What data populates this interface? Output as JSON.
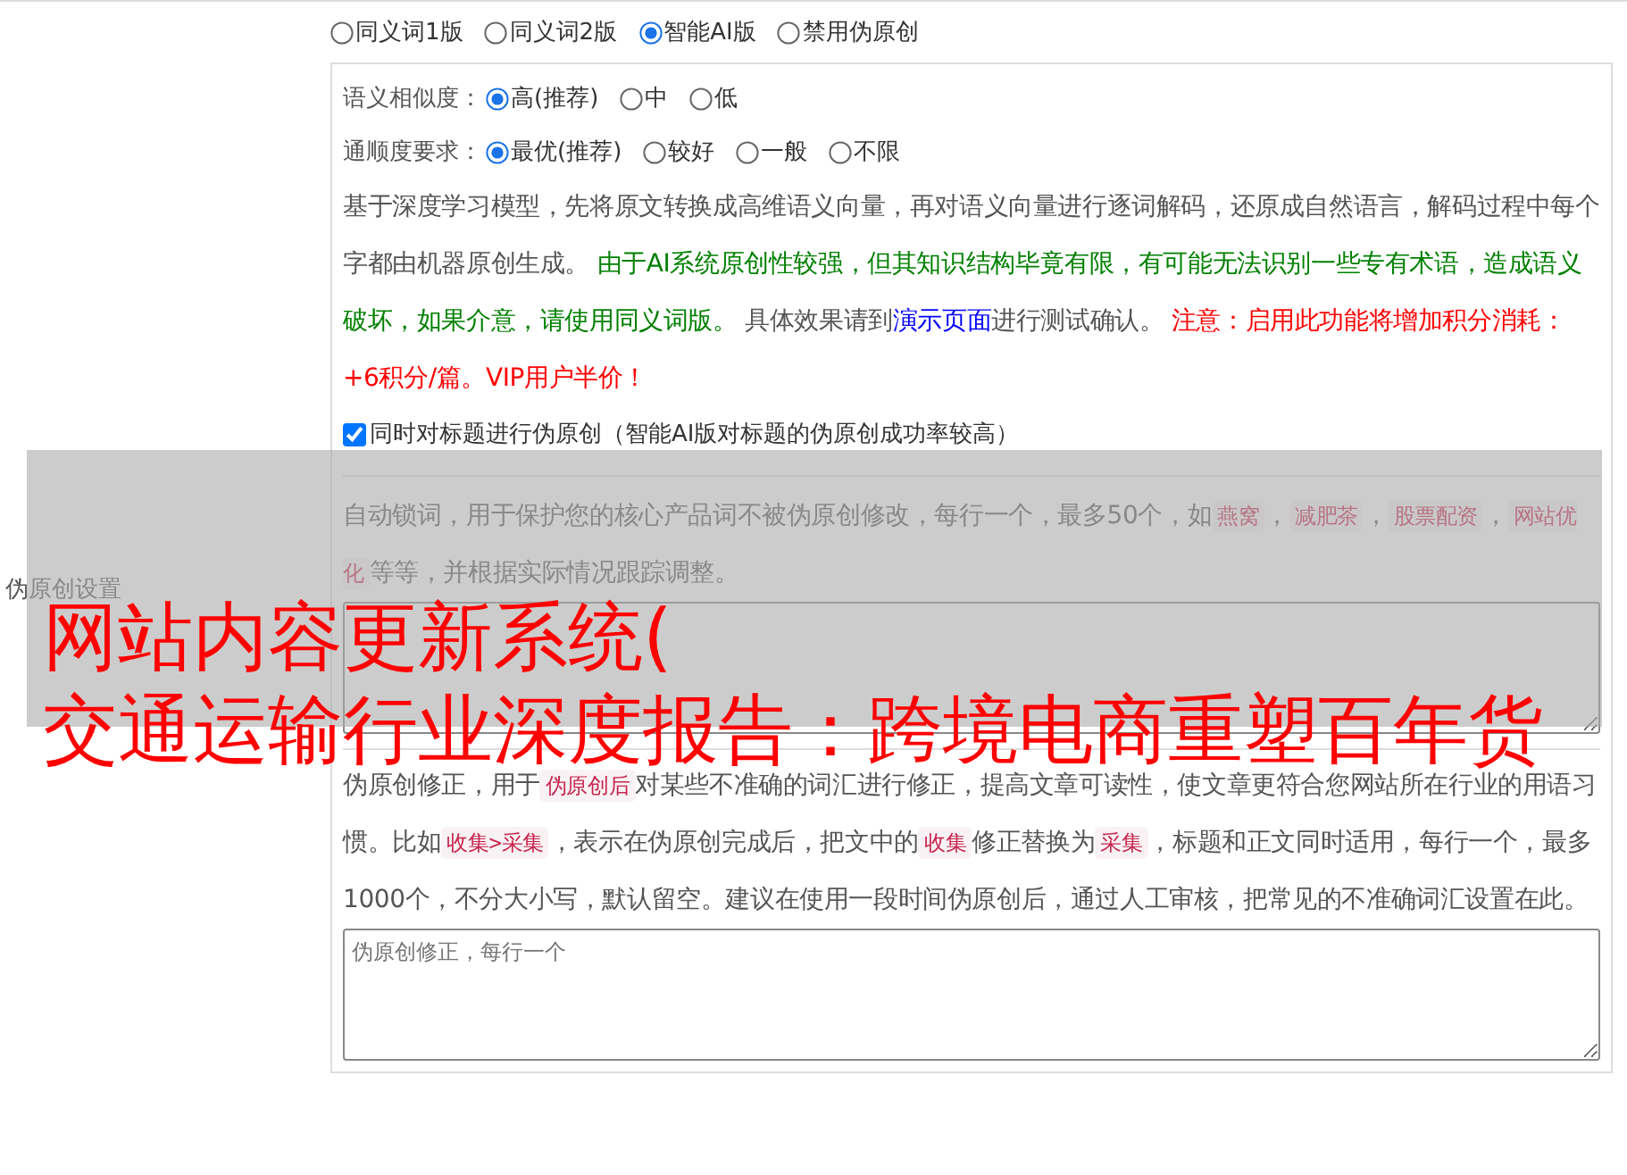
{
  "section_label": "伪原创设置",
  "modes": [
    {
      "label": "同义词1版",
      "selected": false
    },
    {
      "label": "同义词2版",
      "selected": false
    },
    {
      "label": "智能AI版",
      "selected": true
    },
    {
      "label": "禁用伪原创",
      "selected": false
    }
  ],
  "option_groups": [
    {
      "label": "语义相似度：",
      "options": [
        {
          "label": "高(推荐)",
          "selected": true
        },
        {
          "label": "中",
          "selected": false
        },
        {
          "label": "低",
          "selected": false
        }
      ]
    },
    {
      "label": "通顺度要求：",
      "options": [
        {
          "label": "最优(推荐)",
          "selected": true
        },
        {
          "label": "较好",
          "selected": false
        },
        {
          "label": "一般",
          "selected": false
        },
        {
          "label": "不限",
          "selected": false
        }
      ]
    }
  ],
  "ai_description": [
    {
      "kind": "plain",
      "text": "基于深度学习模型，先将原文转换成高维语义向量，再对语义向量进行逐词解码，还原成自然语言，解码过程中每个字都由机器原创生成。 "
    },
    {
      "kind": "green",
      "text": "由于AI系统原创性较强，但其知识结构毕竟有限，有可能无法识别一些专有术语，造成语义破坏，如果介意，请使用同义词版。"
    },
    {
      "kind": "plain",
      "text": " 具体效果请到"
    },
    {
      "kind": "link",
      "text": "演示页面"
    },
    {
      "kind": "plain",
      "text": "进行测试确认。 "
    },
    {
      "kind": "red",
      "text": "注意：启用此功能将增加积分消耗：+6积分/篇。VIP用户半价！"
    }
  ],
  "title_checkbox": {
    "label": "同时对标题进行伪原创（智能AI版对标题的伪原创成功率较高）",
    "checked": true
  },
  "lock_words": {
    "description": [
      {
        "kind": "plain",
        "text": "自动锁词，用于保护您的核心产品词不被伪原创修改，每行一个，最多50个，如"
      },
      {
        "kind": "code",
        "text": "燕窝"
      },
      {
        "kind": "plain",
        "text": "，"
      },
      {
        "kind": "code",
        "text": "减肥茶"
      },
      {
        "kind": "plain",
        "text": "，"
      },
      {
        "kind": "code",
        "text": "股票配资"
      },
      {
        "kind": "plain",
        "text": "，"
      },
      {
        "kind": "code",
        "text": "网站优化"
      },
      {
        "kind": "plain",
        "text": "等等，并根据实际情况跟踪调整。"
      }
    ]
  },
  "corrections": {
    "description": [
      {
        "kind": "plain",
        "text": "伪原创修正，用于"
      },
      {
        "kind": "code",
        "text": "伪原创后"
      },
      {
        "kind": "plain",
        "text": "对某些不准确的词汇进行修正，提高文章可读性，使文章更符合您网站所在行业的用语习惯。比如"
      },
      {
        "kind": "code",
        "text": "收集>采集"
      },
      {
        "kind": "plain",
        "text": "，表示在伪原创完成后，把文中的"
      },
      {
        "kind": "code",
        "text": "收集"
      },
      {
        "kind": "plain",
        "text": "修正替换为"
      },
      {
        "kind": "code",
        "text": "采集"
      },
      {
        "kind": "plain",
        "text": "，标题和正文同时适用，每行一个，最多1000个，不分大小写，默认留空。建议在使用一段时间伪原创后，通过人工审核，把常见的不准确词汇设置在此。"
      }
    ],
    "placeholder": "伪原创修正，每行一个"
  },
  "overlay_caption": [
    "网站内容更新系统(",
    "交通运输行业深度报告：跨境电商重塑百年货"
  ]
}
